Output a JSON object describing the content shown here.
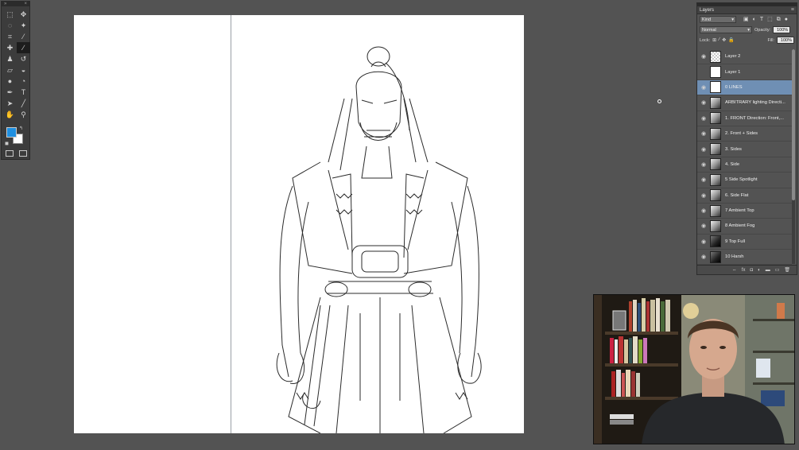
{
  "tools": {
    "header_left": "»",
    "header_right": "×",
    "items": [
      {
        "name": "marquee-tool-icon",
        "glyph": "⬚"
      },
      {
        "name": "move-tool-icon",
        "glyph": "✥"
      },
      {
        "name": "lasso-tool-icon",
        "glyph": "◌"
      },
      {
        "name": "magic-wand-tool-icon",
        "glyph": "✦"
      },
      {
        "name": "crop-tool-icon",
        "glyph": "⌗"
      },
      {
        "name": "eyedropper-tool-icon",
        "glyph": "⁄"
      },
      {
        "name": "healing-brush-tool-icon",
        "glyph": "✚"
      },
      {
        "name": "brush-tool-icon",
        "glyph": "∕"
      },
      {
        "name": "stamp-tool-icon",
        "glyph": "♟"
      },
      {
        "name": "history-brush-tool-icon",
        "glyph": "↺"
      },
      {
        "name": "eraser-tool-icon",
        "glyph": "▱"
      },
      {
        "name": "bucket-tool-icon",
        "glyph": "◒"
      },
      {
        "name": "blur-tool-icon",
        "glyph": "●"
      },
      {
        "name": "dodge-tool-icon",
        "glyph": "◔"
      },
      {
        "name": "pen-tool-icon",
        "glyph": "✒"
      },
      {
        "name": "type-tool-icon",
        "glyph": "T"
      },
      {
        "name": "path-selection-tool-icon",
        "glyph": "➤"
      },
      {
        "name": "line-tool-icon",
        "glyph": "╱"
      },
      {
        "name": "hand-tool-icon",
        "glyph": "✋"
      },
      {
        "name": "zoom-tool-icon",
        "glyph": "⚲"
      }
    ],
    "foreground_color": "#1f8fe0",
    "background_color": "#ffffff",
    "reset_glyph": "◼",
    "swap_glyph": "↰"
  },
  "layers_panel": {
    "title": "Layers",
    "menu_glyph": "≡",
    "filter_kind": "Kind",
    "filter_icons": [
      "▣",
      "◐",
      "T",
      "⬚",
      "⧉",
      "●"
    ],
    "blend_mode": "Normal",
    "opacity_label": "Opacity:",
    "opacity_value": "100%",
    "lock_label": "Lock:",
    "lock_icons": [
      "⊞",
      "∕",
      "✥",
      "🔒"
    ],
    "fill_label": "Fill:",
    "fill_value": "100%",
    "layers": [
      {
        "name": "Layer 2",
        "visible": true,
        "selected": false,
        "thumb": "checker"
      },
      {
        "name": "Layer 1",
        "visible": false,
        "selected": false,
        "thumb": "white"
      },
      {
        "name": "0 LINES",
        "visible": true,
        "selected": true,
        "thumb": "white"
      },
      {
        "name": "ARBITRARY lighting Directi...",
        "visible": true,
        "selected": false,
        "thumb": "dark"
      },
      {
        "name": "1. FRONT Direction: Front,...",
        "visible": true,
        "selected": false,
        "thumb": "dark"
      },
      {
        "name": "2. Front + Sides",
        "visible": true,
        "selected": false,
        "thumb": "dark"
      },
      {
        "name": "3. Sides",
        "visible": true,
        "selected": false,
        "thumb": "dark"
      },
      {
        "name": "4. Side",
        "visible": true,
        "selected": false,
        "thumb": "dark"
      },
      {
        "name": "5 Side Spotlight",
        "visible": true,
        "selected": false,
        "thumb": "dark"
      },
      {
        "name": "6. Side Flat",
        "visible": true,
        "selected": false,
        "thumb": "dark"
      },
      {
        "name": "7 Ambient Top",
        "visible": true,
        "selected": false,
        "thumb": "dark"
      },
      {
        "name": "8 Ambient Fog",
        "visible": true,
        "selected": false,
        "thumb": "dark"
      },
      {
        "name": "9 Top Full",
        "visible": true,
        "selected": false,
        "thumb": "darker"
      },
      {
        "name": "10 Harsh",
        "visible": true,
        "selected": false,
        "thumb": "darker"
      }
    ],
    "footer_icons": [
      "⇔",
      "fx",
      "◘",
      "◐",
      "▬",
      "▭",
      "🗑"
    ]
  }
}
